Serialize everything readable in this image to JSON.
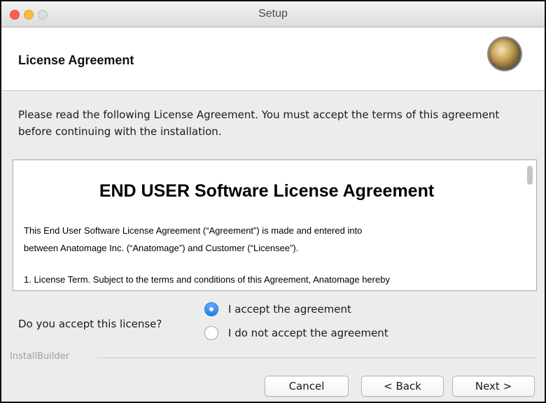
{
  "window": {
    "title": "Setup"
  },
  "header": {
    "title": "License Agreement",
    "logo_icon": "installer-logo-icon"
  },
  "instructions": "Please read the following License Agreement. You must accept the terms of this agreement before continuing with the installation.",
  "license": {
    "heading": "END USER Software License Agreement",
    "paragraph_line1": "This End User Software License Agreement (“Agreement”) is made and entered into",
    "paragraph_line2": "between Anatomage Inc. (“Anatomage”) and Customer (“Licensee”).",
    "clause_partial": "1. License Term. Subject to the terms and conditions of this Agreement, Anatomage hereby"
  },
  "acceptance": {
    "question": "Do you accept this license?",
    "options": [
      {
        "label": "I accept the agreement",
        "selected": true
      },
      {
        "label": "I do not accept the agreement",
        "selected": false
      }
    ]
  },
  "footer": {
    "brand": "InstallBuilder",
    "buttons": {
      "cancel": "Cancel",
      "back": "< Back",
      "next": "Next >"
    }
  },
  "colors": {
    "radio_selected": "#1d7ff2",
    "close": "#fc605c",
    "minimize": "#fdbc40"
  }
}
